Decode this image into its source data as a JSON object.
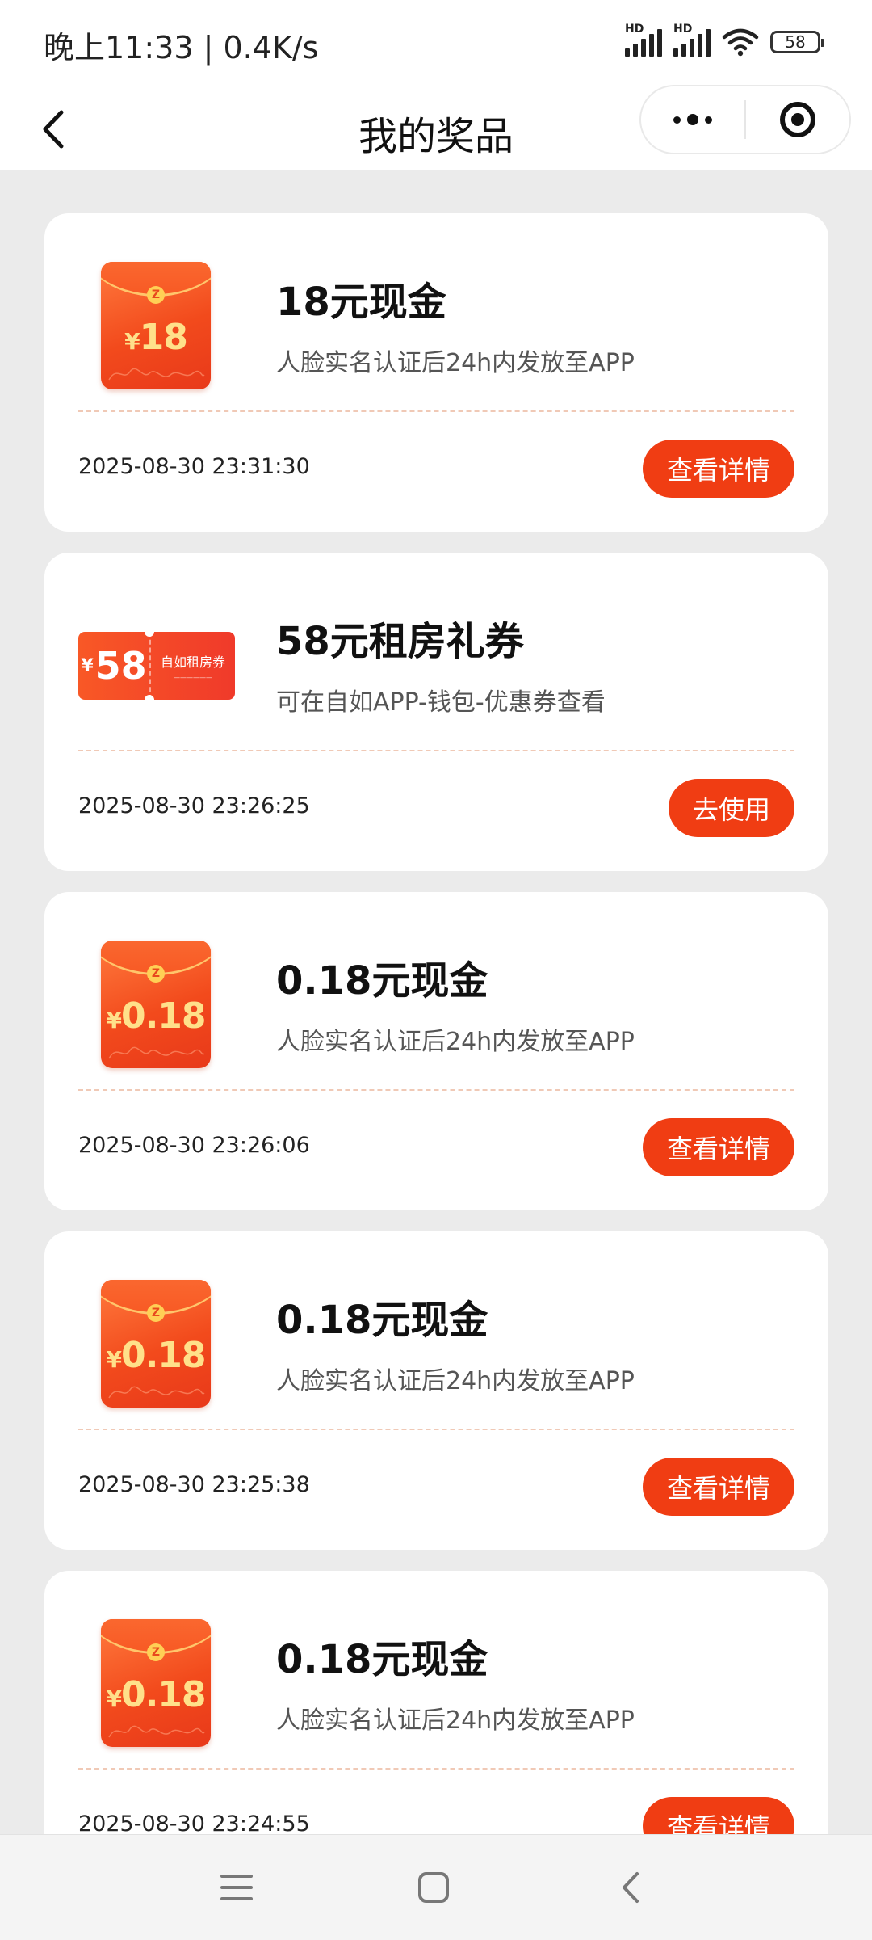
{
  "status_bar": {
    "time_speed": "晚上11:33 | 0.4K/s",
    "signal1_label": "HD",
    "signal2_label": "HD",
    "battery": "58"
  },
  "nav": {
    "title": "我的奖品",
    "back_icon": "chevron-left-icon",
    "more_icon": "more-dots-icon",
    "close_icon": "target-icon"
  },
  "prizes": [
    {
      "name": "18元现金",
      "desc": "人脸实名认证后24h内发放至APP",
      "time": "2025-08-30 23:31:30",
      "action": "查看详情",
      "art": "red-envelope",
      "art_currency": "¥",
      "art_amount": "18"
    },
    {
      "name": "58元租房礼券",
      "desc": "可在自如APP-钱包-优惠券查看",
      "time": "2025-08-30 23:26:25",
      "action": "去使用",
      "art": "coupon",
      "art_currency": "¥",
      "art_amount": "58",
      "art_coupon_title": "自如租房券"
    },
    {
      "name": "0.18元现金",
      "desc": "人脸实名认证后24h内发放至APP",
      "time": "2025-08-30 23:26:06",
      "action": "查看详情",
      "art": "red-envelope",
      "art_currency": "¥",
      "art_amount": "0.18"
    },
    {
      "name": "0.18元现金",
      "desc": "人脸实名认证后24h内发放至APP",
      "time": "2025-08-30 23:25:38",
      "action": "查看详情",
      "art": "red-envelope",
      "art_currency": "¥",
      "art_amount": "0.18"
    },
    {
      "name": "0.18元现金",
      "desc": "人脸实名认证后24h内发放至APP",
      "time": "2025-08-30 23:24:55",
      "action": "查看详情",
      "art": "red-envelope",
      "art_currency": "¥",
      "art_amount": "0.18"
    }
  ],
  "envelope_coin": "Z",
  "colors": {
    "accent": "#f03d13",
    "background": "#ebebeb",
    "card": "#ffffff",
    "envelope_gold": "#ffe08a"
  },
  "system_nav": {
    "menu_icon": "menu-icon",
    "home_icon": "home-square-icon",
    "back_icon": "back-triangle-icon"
  }
}
